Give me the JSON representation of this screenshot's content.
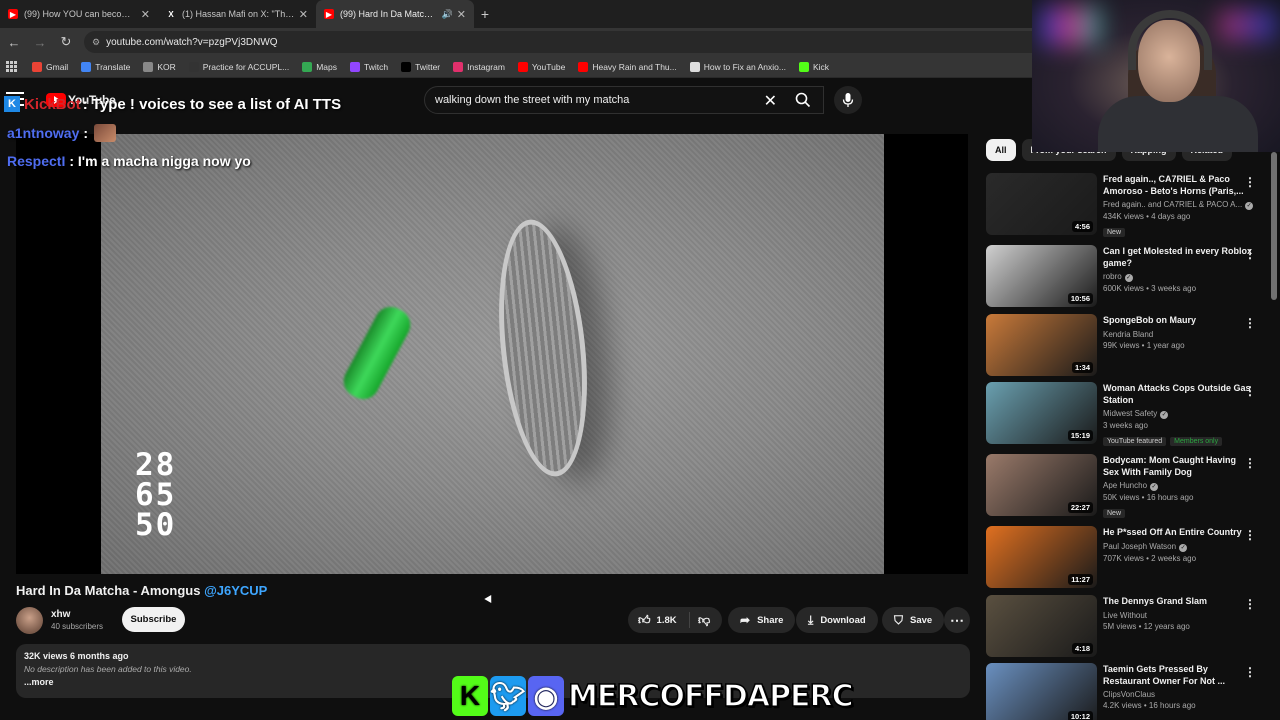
{
  "browser": {
    "tabs": [
      {
        "label": "(99) How YOU can become a g",
        "active": false,
        "audio": false
      },
      {
        "label": "(1) Hassan Mafi  on X: \"The po",
        "active": false,
        "audio": false
      },
      {
        "label": "(99) Hard In Da Matcha - A",
        "active": true,
        "audio": true
      }
    ],
    "url": "youtube.com/watch?v=pzgPVj3DNWQ",
    "bookmarks": [
      {
        "label": "Gmail",
        "icon": "gmail-icon",
        "color": "#ea4335"
      },
      {
        "label": "Translate",
        "icon": "translate-icon",
        "color": "#4285f4"
      },
      {
        "label": "KOR",
        "icon": "kor-icon",
        "color": "#888888"
      },
      {
        "label": "Practice for ACCUPL...",
        "icon": "practice-icon",
        "color": "#333333"
      },
      {
        "label": "Maps",
        "icon": "maps-icon",
        "color": "#34a853"
      },
      {
        "label": "Twitch",
        "icon": "twitch-icon",
        "color": "#9146ff"
      },
      {
        "label": "Twitter",
        "icon": "x-icon",
        "color": "#000000"
      },
      {
        "label": "Instagram",
        "icon": "instagram-icon",
        "color": "#e1306c"
      },
      {
        "label": "YouTube",
        "icon": "youtube-icon",
        "color": "#ff0000"
      },
      {
        "label": "Heavy Rain and Thu...",
        "icon": "youtube-icon",
        "color": "#ff0000"
      },
      {
        "label": "How to Fix an Anxio...",
        "icon": "web-icon",
        "color": "#dddddd"
      },
      {
        "label": "Kick",
        "icon": "kick-icon",
        "color": "#53fc18"
      }
    ]
  },
  "youtube": {
    "logo_text": "YouTube",
    "search_value": "walking down the street with my matcha"
  },
  "overlay": {
    "tts_user": "KickBot",
    "tts_message": ": Type ! voices to see a list of AI TTS",
    "chat": [
      {
        "user": "a1ntnoway",
        "text": ":"
      },
      {
        "user": "RespectI",
        "text": ": I'm a macha nigga now yo"
      }
    ],
    "video_digits": [
      "28",
      "65",
      "50"
    ],
    "social_handle": "MERCOFFDAPERC"
  },
  "video": {
    "title": "Hard In Da Matcha - Amongus",
    "title_tag": "@J6YCUP",
    "channel": "xhw",
    "subscribers": "40 subscribers",
    "subscribe_label": "Subscribe",
    "likes": "1.8K",
    "share_label": "Share",
    "download_label": "Download",
    "save_label": "Save",
    "views_date": "32K views  6 months ago",
    "description": "No description has been added to this video.",
    "more_label": "...more"
  },
  "sidebar": {
    "chips": [
      "All",
      "From your search",
      "Rapping",
      "Related"
    ],
    "items": [
      {
        "title": "Fred again.., CA7RIEL & Paco Amoroso - Beto's Horns (Paris,...",
        "channel": "Fred again..   and CA7RIEL & PACO A...",
        "stats": "434K views • 4 days ago",
        "badges": [
          "New"
        ],
        "duration": "4:56",
        "thumb": "#2a2a2a",
        "verified": true
      },
      {
        "title": "Can I get Molested in every Roblox game?",
        "channel": "robro",
        "stats": "600K views • 3 weeks ago",
        "badges": [],
        "duration": "10:56",
        "thumb": "#d0d0d0",
        "verified": true
      },
      {
        "title": "SpongeBob on Maury",
        "channel": "Kendria Bland",
        "stats": "99K views • 1 year ago",
        "badges": [],
        "duration": "1:34",
        "thumb": "#c97a3a",
        "verified": false
      },
      {
        "title": "Woman Attacks Cops Outside Gas Station",
        "channel": "Midwest Safety",
        "stats": "3 weeks ago",
        "badges": [
          "YouTube featured",
          "Members only"
        ],
        "duration": "15:19",
        "thumb": "#6aa0b0",
        "verified": true
      },
      {
        "title": "Bodycam: Mom Caught Having Sex With Family Dog",
        "channel": "Ape Huncho",
        "stats": "50K views • 16 hours ago",
        "badges": [
          "New"
        ],
        "duration": "22:27",
        "thumb": "#9a7a6a",
        "verified": true
      },
      {
        "title": "He P*ssed Off An Entire Country",
        "channel": "Paul Joseph Watson",
        "stats": "707K views • 2 weeks ago",
        "badges": [],
        "duration": "11:27",
        "thumb": "#e07020",
        "verified": true
      },
      {
        "title": "The Dennys Grand Slam",
        "channel": "Live Without",
        "stats": "5M views • 12 years ago",
        "badges": [],
        "duration": "4:18",
        "thumb": "#5a5040",
        "verified": false
      },
      {
        "title": "Taemin Gets Pressed By Restaurant Owner For Not ...",
        "channel": "ClipsVonClaus",
        "stats": "4.2K views • 16 hours ago",
        "badges": [],
        "duration": "10:12",
        "thumb": "#6a90c0",
        "verified": false
      }
    ]
  }
}
